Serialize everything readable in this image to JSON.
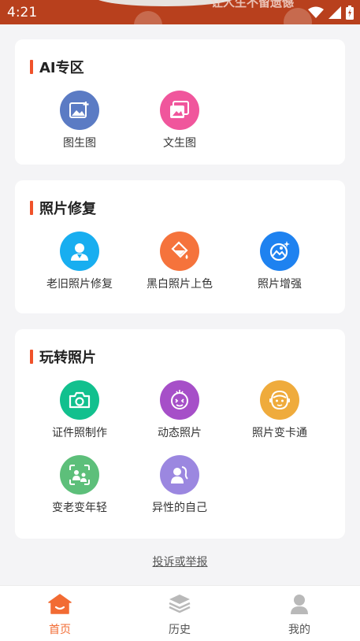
{
  "status_bar": {
    "time": "4:21",
    "banner_text": "让人生不留遗憾"
  },
  "sections": [
    {
      "title": "AI专区",
      "items": [
        {
          "label": "图生图",
          "icon": "image-plus-icon",
          "color": "#5b7bc4"
        },
        {
          "label": "文生图",
          "icon": "photo-gallery-icon",
          "color": "#f0569c"
        }
      ]
    },
    {
      "title": "照片修复",
      "items": [
        {
          "label": "老旧照片修复",
          "icon": "person-portrait-icon",
          "color": "#18aef0"
        },
        {
          "label": "黑白照片上色",
          "icon": "paint-bucket-icon",
          "color": "#f5733c"
        },
        {
          "label": "照片增强",
          "icon": "sparkle-image-icon",
          "color": "#1e82f0"
        }
      ]
    },
    {
      "title": "玩转照片",
      "items": [
        {
          "label": "证件照制作",
          "icon": "camera-icon",
          "color": "#12c08e"
        },
        {
          "label": "动态照片",
          "icon": "animated-face-icon",
          "color": "#a64fc8"
        },
        {
          "label": "照片变卡通",
          "icon": "cartoon-face-icon",
          "color": "#efab3c"
        },
        {
          "label": "变老变年轻",
          "icon": "face-scan-icon",
          "color": "#5dbf7a"
        },
        {
          "label": "异性的自己",
          "icon": "gender-swap-icon",
          "color": "#9b87e0"
        }
      ]
    }
  ],
  "complaint_link": "投诉或举报",
  "tabs": [
    {
      "label": "首页",
      "icon": "home-icon",
      "active": true,
      "color": "#f26b33"
    },
    {
      "label": "历史",
      "icon": "layers-icon",
      "active": false,
      "color": "#555555"
    },
    {
      "label": "我的",
      "icon": "user-icon",
      "active": false,
      "color": "#555555"
    }
  ]
}
